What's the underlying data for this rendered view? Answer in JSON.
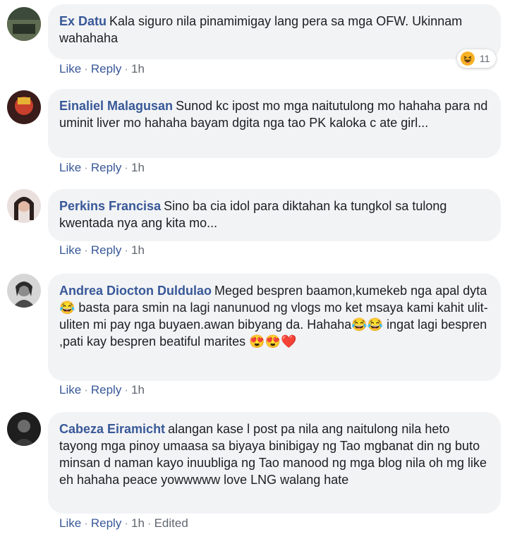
{
  "comments": [
    {
      "author": "Ex Datu",
      "text": "Kala siguro nila pinamimigay lang pera sa mga OFW. Ukinnam wahahaha",
      "actions": {
        "like": "Like",
        "reply": "Reply",
        "time": "1h"
      },
      "reaction": {
        "icon": "haha-emoji-icon",
        "count": "11"
      }
    },
    {
      "author": "Einaliel Malagusan",
      "text": "Sunod kc ipost mo mga naitutulong mo hahaha para nd uminit liver mo hahaha bayam dgita nga tao PK kaloka c ate girl...",
      "actions": {
        "like": "Like",
        "reply": "Reply",
        "time": "1h"
      }
    },
    {
      "author": "Perkins Francisa",
      "text": "Sino ba cia idol para diktahan ka tungkol sa tulong kwentada nya ang kita mo...",
      "actions": {
        "like": "Like",
        "reply": "Reply",
        "time": "1h"
      }
    },
    {
      "author": "Andrea Diocton Duldulao",
      "text_parts": [
        "Meged bespren baamon,kumekeb nga apal dyta",
        "😂",
        " basta para smin na lagi nanunuod ng vlogs mo ket msaya kami kahit ulit-uliten mi pay nga buyaen.awan bibyang da. Hahaha",
        "😂😂",
        " ingat lagi bespren ,pati kay bespren beatiful marites ",
        "😍😍❤️"
      ],
      "actions": {
        "like": "Like",
        "reply": "Reply",
        "time": "1h"
      }
    },
    {
      "author": "Cabeza Eiramicht",
      "text": "alangan kase l post pa nila ang naitulong nila heto tayong mga pinoy umaasa sa biyaya binibigay ng Tao mgbanat din ng buto minsan d naman kayo inuubliga ng Tao manood ng mga blog nila oh mg like eh hahaha peace yowwwww love LNG walang hate",
      "actions": {
        "like": "Like",
        "reply": "Reply",
        "time": "1h",
        "edited": "Edited"
      }
    }
  ],
  "colors": {
    "author": "#385898",
    "bubble": "#f2f3f5",
    "meta": "#606770"
  }
}
